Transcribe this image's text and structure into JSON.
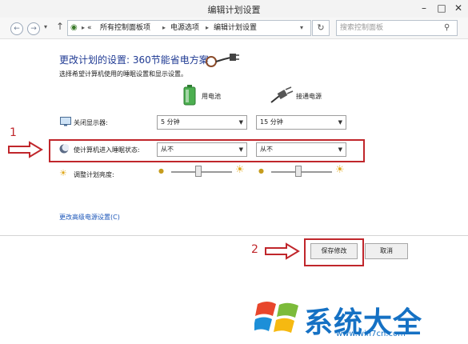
{
  "window": {
    "title": "编辑计划设置"
  },
  "nav": {
    "breadcrumb": [
      "«",
      "所有控制面板项",
      "电源选项",
      "编辑计划设置"
    ],
    "search_placeholder": "搜索控制面板"
  },
  "main": {
    "heading": "更改计划的设置: 360节能省电方案",
    "subtext": "选择希望计算机使用的睡眠设置和显示设置。",
    "columns": {
      "battery": "用电池",
      "plugged": "接通电源"
    },
    "rows": [
      {
        "label": "关闭显示器:",
        "battery_value": "5 分钟",
        "plugged_value": "15 分钟"
      },
      {
        "label": "使计算机进入睡眠状态:",
        "battery_value": "从不",
        "plugged_value": "从不"
      },
      {
        "label": "调整计划亮度:",
        "battery_level": 0.45,
        "plugged_level": 0.45
      }
    ],
    "advanced_link": "更改高级电源设置(C)"
  },
  "buttons": {
    "save": "保存修改",
    "cancel": "取消"
  },
  "annotations": {
    "marker_1": "1",
    "marker_2": "2",
    "color": "#c0262b"
  },
  "watermark": {
    "text": "系统大全",
    "url": "www.win7cn.com"
  }
}
